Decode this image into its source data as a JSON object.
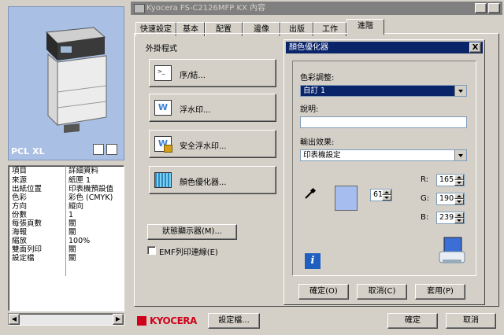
{
  "left": {
    "preview_label": "PCL XL",
    "props_header": {
      "item": "項目",
      "detail": "詳細資料"
    },
    "props": [
      {
        "k": "來源",
        "v": "紙匣 1"
      },
      {
        "k": "出紙位置",
        "v": "印表機預設值"
      },
      {
        "k": "色彩",
        "v": "彩色 (CMYK)"
      },
      {
        "k": "方向",
        "v": "縱向"
      },
      {
        "k": "份數",
        "v": "1"
      },
      {
        "k": "每張頁數",
        "v": "關"
      },
      {
        "k": "海報",
        "v": "關"
      },
      {
        "k": "縮放",
        "v": "100%"
      },
      {
        "k": "雙面列印",
        "v": "關"
      },
      {
        "k": "設定檔",
        "v": "關"
      }
    ]
  },
  "window": {
    "title": "Kyocera FS-C2126MFP KX 內容",
    "help_btn": "?",
    "close_btn": "X",
    "tabs": [
      "快速設定",
      "基本",
      "配置",
      "邊像",
      "出版",
      "工作",
      "進階"
    ],
    "active_tab": "進階",
    "plugins_label": "外掛程式",
    "big_buttons": [
      "序/結...",
      "浮水印...",
      "安全浮水印...",
      "顏色優化器..."
    ],
    "status_btn": "狀態顯示器(M)...",
    "emf_label": "EMF列印連線(E)",
    "logo": "KYOCERA",
    "profile_btn": "設定檔...",
    "ok_btn": "確定",
    "cancel_btn": "取消"
  },
  "dialog": {
    "title": "顏色優化器",
    "close": "X",
    "color_adjust_label": "色彩調整:",
    "color_adjust_value": "自訂 1",
    "description_label": "說明:",
    "description_value": "",
    "output_label": "輸出效果:",
    "output_value": "印表機設定",
    "tolerance": "61",
    "r_label": "R:",
    "g_label": "G:",
    "b_label": "B:",
    "r": "165",
    "g": "190",
    "b": "239",
    "swatch_color": "#a5beef",
    "ok": "確定(O)",
    "cancel": "取消(C)",
    "apply": "套用(P)"
  }
}
